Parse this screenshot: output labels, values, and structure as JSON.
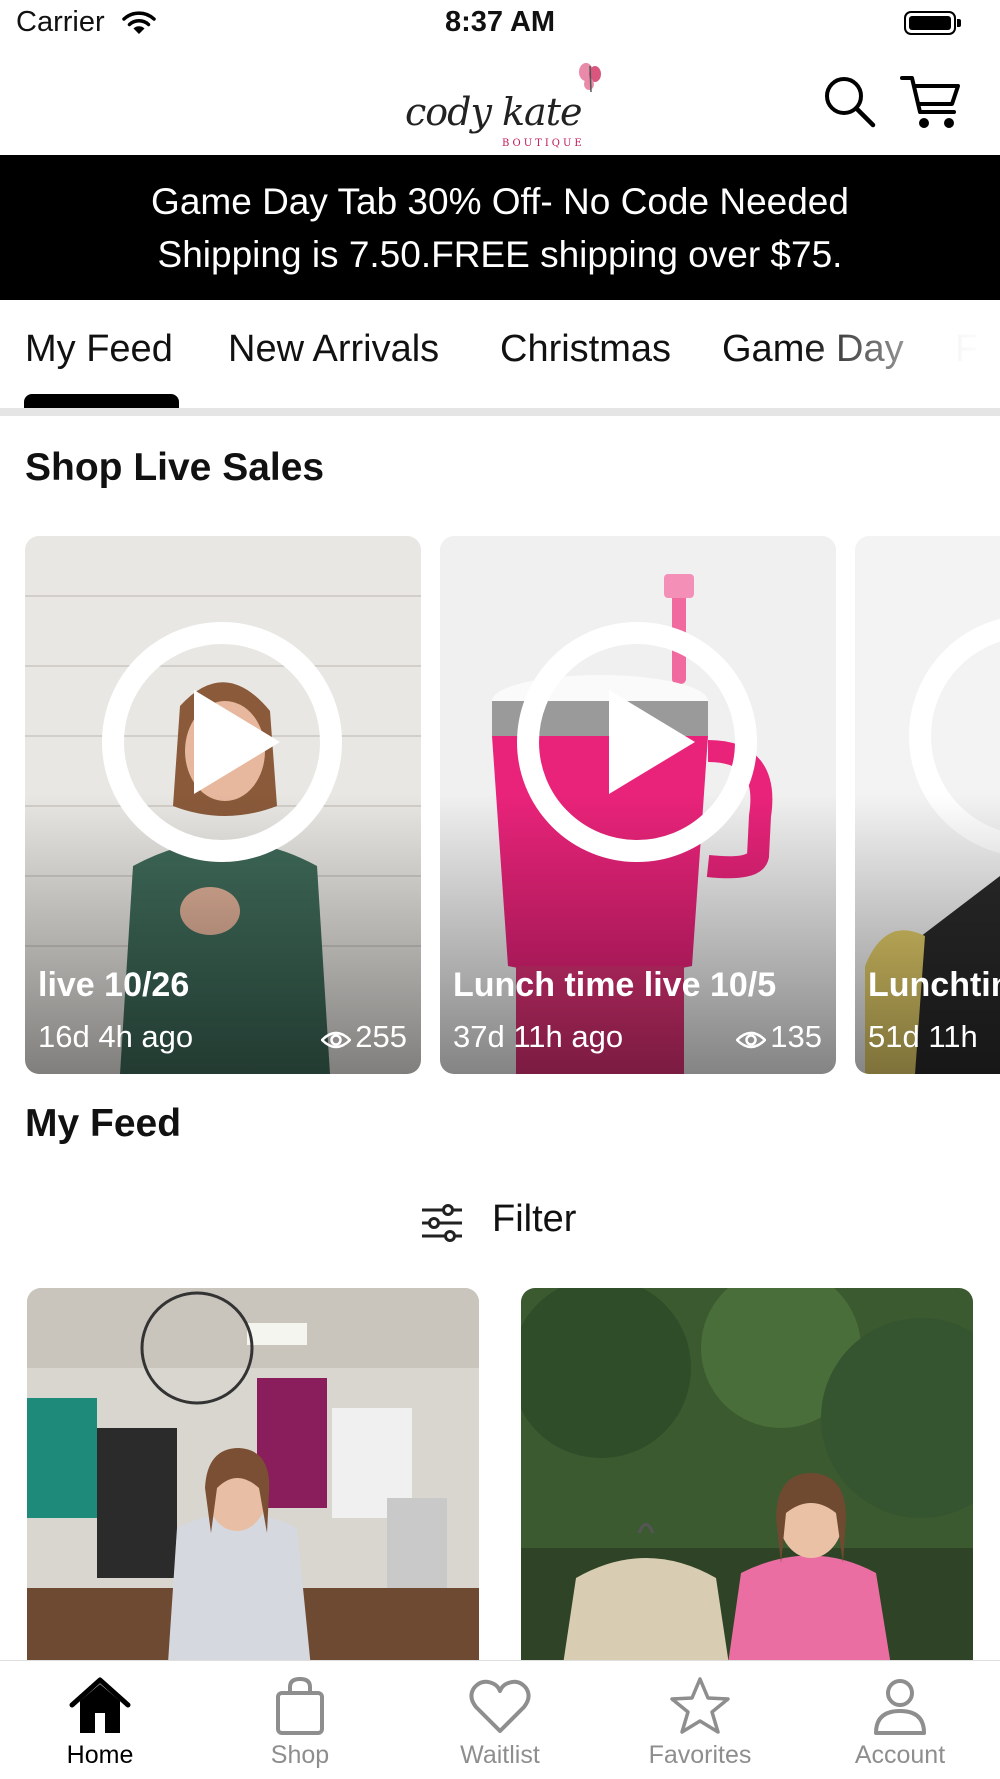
{
  "status_bar": {
    "carrier": "Carrier",
    "time": "8:37 AM"
  },
  "header": {
    "logo_text": "cody kate",
    "logo_subtext": "BOUTIQUE",
    "search_icon": "search-icon",
    "cart_icon": "cart-icon"
  },
  "promo": {
    "line1": "Game Day Tab 30% Off- No Code Needed",
    "line2": "Shipping is 7.50.FREE shipping over $75."
  },
  "tabs": [
    {
      "label": "My Feed",
      "active": true
    },
    {
      "label": "New Arrivals",
      "active": false
    },
    {
      "label": "Christmas",
      "active": false
    },
    {
      "label": "Game Day",
      "active": false
    },
    {
      "label": "F",
      "active": false
    }
  ],
  "live_sales": {
    "title": "Shop Live Sales",
    "items": [
      {
        "title": "live 10/26",
        "age": "16d 4h ago",
        "views": "255"
      },
      {
        "title": "Lunch time live 10/5",
        "age": "37d 11h ago",
        "views": "135"
      },
      {
        "title": "Lunchtime",
        "age": "51d 11h",
        "views": ""
      }
    ]
  },
  "feed": {
    "title": "My Feed",
    "filter_label": "Filter"
  },
  "tab_bar": [
    {
      "label": "Home",
      "icon": "home-icon",
      "active": true
    },
    {
      "label": "Shop",
      "icon": "bag-icon",
      "active": false
    },
    {
      "label": "Waitlist",
      "icon": "heart-icon",
      "active": false
    },
    {
      "label": "Favorites",
      "icon": "star-icon",
      "active": false
    },
    {
      "label": "Account",
      "icon": "person-icon",
      "active": false
    }
  ],
  "colors": {
    "banner_bg": "#000000",
    "accent_pink": "#e91e63",
    "inactive_gray": "#8e8e8e"
  }
}
